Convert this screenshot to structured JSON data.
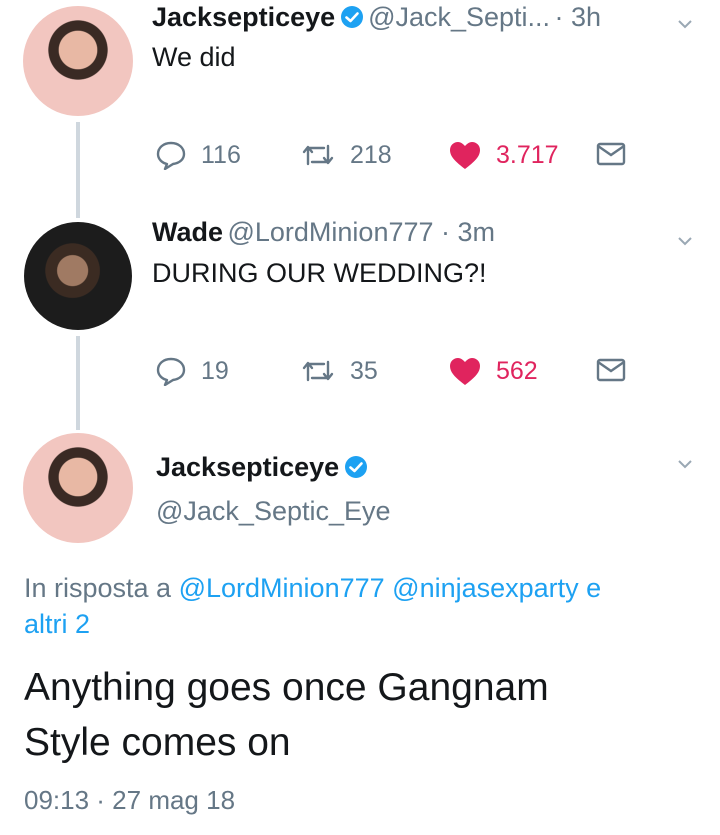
{
  "tweets": [
    {
      "name": "Jacksepticeye",
      "handle": "@Jack_Septi...",
      "time": "· 3h",
      "text": "We did",
      "replies": "116",
      "retweets": "218",
      "likes": "3.717"
    },
    {
      "name": "Wade",
      "handle": "@LordMinion777 · 3m",
      "text": "DURING OUR WEDDING?!",
      "replies": "19",
      "retweets": "35",
      "likes": "562"
    }
  ],
  "main": {
    "name": "Jacksepticeye",
    "handle": "@Jack_Septic_Eye",
    "reply_prefix": "In risposta a",
    "reply_mention_1": "@LordMinion777",
    "reply_mention_2": "@ninjasexparty e",
    "reply_more": "altri 2",
    "text_line1": "Anything goes once Gangnam",
    "text_line2": "Style comes on",
    "timestamp": "09:13 · 27 mag 18"
  },
  "colors": {
    "accent": "#1da1f2",
    "like": "#e0245e",
    "muted": "#657786",
    "thread": "#cfd7de"
  },
  "icons": [
    "reply-icon",
    "retweet-icon",
    "heart-icon",
    "message-icon",
    "verified-icon",
    "chevron-down-icon"
  ]
}
